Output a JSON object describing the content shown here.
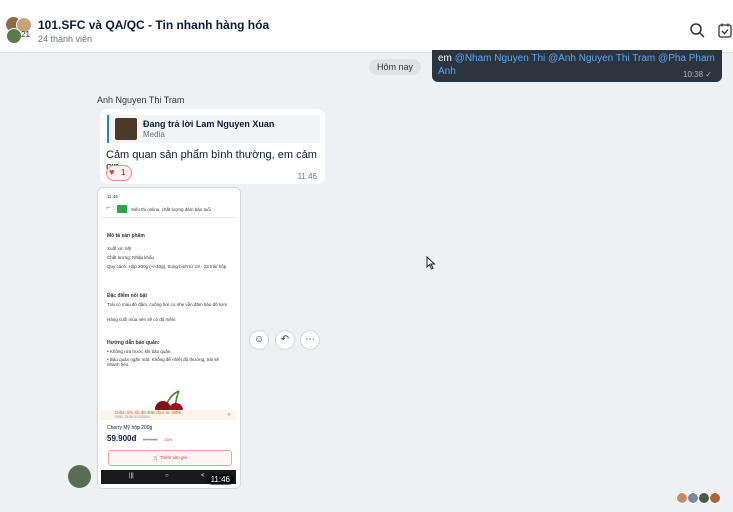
{
  "header": {
    "avatar_count": "21",
    "title": "101.SFC và QA/QC - Tin nhanh hàng hóa",
    "subtitle": "24 thành viên",
    "icons": [
      "search-icon",
      "task-icon"
    ]
  },
  "chat": {
    "date_divider": "Hôm nay",
    "outgoing": {
      "text_lead": "em",
      "mentions": "@Nham Nguyen Thi @Anh Nguyen Thi Tram @Pha Pham Anh",
      "time": "10:38",
      "status": "✓"
    },
    "incoming": {
      "sender": "Anh Nguyen Thi Tram",
      "reply": {
        "title": "Đang trả lời Lam Nguyen Xuan",
        "subtitle": "Media"
      },
      "text": "Cảm quan sản phẩm bình thường, em cảm ơn",
      "reaction": {
        "emoji": "heart",
        "count": "1"
      },
      "time": "11:46"
    },
    "image": {
      "time": "11:46",
      "screenshot": {
        "status_time": "11:45",
        "bar_title": "Siêu thị online, chất lượng đảm bảo tuổi",
        "section_desc": "Mô tả sản phẩm",
        "origin": "Xuất xứ: Mỹ",
        "quality": "Chất lượng: Nhập khẩu",
        "spec": "Quy cách: Hộp 200g (+/-10g), trung bình từ 19 - 23 trái/ hộp.",
        "section_feature": "Đặc điểm nổi bật",
        "feature1": "Trái có màu đỏ đậm, cuống hơi co nhẹ vẫn đảm bảo độ tươi",
        "feature2": "Hàng cuối mùa nên sẽ có độ mềm",
        "section_storage": "Hướng dẫn bảo quản:",
        "storage1": "• Không rửa trước khi bảo quản.",
        "storage2": "• Bảo quản ngăn mát. Không để nhiệt độ thường, trái sẽ nhanh héo.",
        "promo": "Giảm 5% tối đa 40K đơn từ 199K",
        "promo_hsd": "HSD: 23:59 31/3/2024",
        "product_name": "Cherry Mỹ hộp 200g",
        "price": "59.900đ",
        "old_price": "89.000đ",
        "discount": "-33%",
        "cart_button": "Thêm vào giỏ",
        "nav_time": "11:46"
      }
    },
    "actions": [
      "emoji-icon",
      "reply-icon",
      "more-icon"
    ]
  },
  "colors": {
    "accent": "#2d7be0",
    "dark_bubble": "#2c3440",
    "reaction": "#e0343d"
  }
}
